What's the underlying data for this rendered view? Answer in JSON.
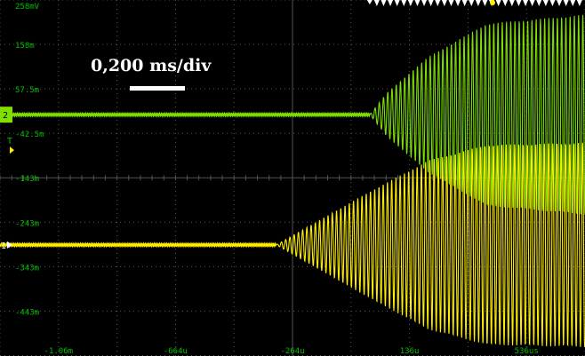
{
  "chart_data": {
    "type": "line",
    "title": "",
    "xlabel": "",
    "ylabel": "",
    "timebase_annotation": "0,200 ms/div",
    "y_tick_labels": [
      "258mV",
      "158m",
      "57.5m",
      "-42.5m",
      "-143m",
      "-243m",
      "-343m",
      "-443m"
    ],
    "x_tick_labels": [
      "-1.06m",
      "-664u",
      "-264u",
      "136u",
      "536us"
    ],
    "ylim_mV": [
      -543,
      258
    ],
    "xlim_us": [
      -1264,
      736
    ],
    "series": [
      {
        "channel": "2",
        "color": "#7fe000",
        "offset_mV": 0,
        "burst_start_us": 0,
        "envelope_mV": [
          [
            0,
            0
          ],
          [
            60,
            50
          ],
          [
            200,
            130
          ],
          [
            400,
            205
          ],
          [
            736,
            225
          ]
        ]
      },
      {
        "channel": "1",
        "color": "#ffee00",
        "offset_mV": -293,
        "burst_start_us": -320,
        "envelope_mV": [
          [
            -320,
            0
          ],
          [
            -200,
            45
          ],
          [
            0,
            120
          ],
          [
            200,
            190
          ],
          [
            400,
            225
          ],
          [
            736,
            230
          ]
        ]
      }
    ]
  },
  "markers": {
    "trigger_label": "T",
    "channel1_label": "1",
    "channel2_label": "2"
  },
  "colors": {
    "ch1": "#ffee00",
    "ch2": "#7fe000",
    "grid": "#555555",
    "background": "#000000",
    "axis_text": "#00c000",
    "trigger_marker": "#ffee00"
  }
}
